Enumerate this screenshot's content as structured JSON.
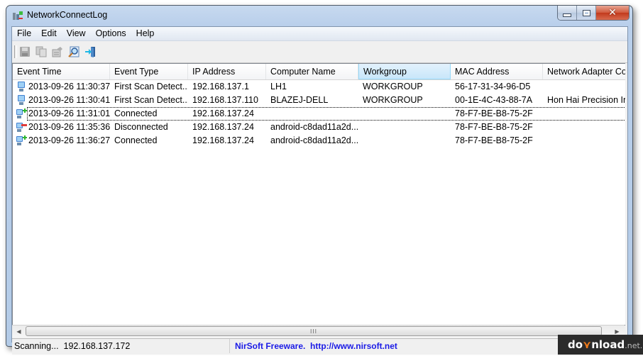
{
  "window": {
    "title": "NetworkConnectLog",
    "caption_buttons": {
      "minimize": "minimize",
      "maximize": "maximize",
      "close": "✕"
    }
  },
  "menu": [
    {
      "label": "File"
    },
    {
      "label": "Edit"
    },
    {
      "label": "View"
    },
    {
      "label": "Options"
    },
    {
      "label": "Help"
    }
  ],
  "toolbar": [
    {
      "icon": "save-icon",
      "enabled": false
    },
    {
      "icon": "copy-icon",
      "enabled": false
    },
    {
      "icon": "properties-icon",
      "enabled": false
    },
    {
      "icon": "find-icon",
      "enabled": true
    },
    {
      "icon": "exit-icon",
      "enabled": true
    }
  ],
  "table": {
    "columns": [
      {
        "label": "Event Time"
      },
      {
        "label": "Event Type"
      },
      {
        "label": "IP Address"
      },
      {
        "label": "Computer Name"
      },
      {
        "label": "Workgroup",
        "sorted": true
      },
      {
        "label": "MAC Address"
      },
      {
        "label": "Network Adapter Company"
      }
    ],
    "rows": [
      {
        "icon": "computer",
        "event_time": "2013-09-26 11:30:37",
        "event_type": "First Scan Detect...",
        "ip": "192.168.137.1",
        "computer": "LH1",
        "workgroup": "WORKGROUP",
        "mac": "56-17-31-34-96-D5",
        "adapter": ""
      },
      {
        "icon": "computer",
        "event_time": "2013-09-26 11:30:41",
        "event_type": "First Scan Detect...",
        "ip": "192.168.137.110",
        "computer": "BLAZEJ-DELL",
        "workgroup": "WORKGROUP",
        "mac": "00-1E-4C-43-88-7A",
        "adapter": "Hon Hai Precision Ind."
      },
      {
        "icon": "computer-connected",
        "event_time": "2013-09-26 11:31:01",
        "event_type": "Connected",
        "ip": "192.168.137.24",
        "computer": "",
        "workgroup": "",
        "mac": "78-F7-BE-B8-75-2F",
        "adapter": "",
        "focused": true
      },
      {
        "icon": "computer-disconnected",
        "event_time": "2013-09-26 11:35:36",
        "event_type": "Disconnected",
        "ip": "192.168.137.24",
        "computer": "android-c8dad11a2d...",
        "workgroup": "",
        "mac": "78-F7-BE-B8-75-2F",
        "adapter": ""
      },
      {
        "icon": "computer-connected",
        "event_time": "2013-09-26 11:36:27",
        "event_type": "Connected",
        "ip": "192.168.137.24",
        "computer": "android-c8dad11a2d...",
        "workgroup": "",
        "mac": "78-F7-BE-B8-75-2F",
        "adapter": ""
      }
    ]
  },
  "hscroll": {
    "grip": "III"
  },
  "status": {
    "left": "Scanning...  192.168.137.172",
    "link": "NirSoft Freeware.  http://www.nirsoft.net"
  },
  "watermark": {
    "pre": "do",
    "arrow": "¥",
    "post": "nload",
    "tld": ".net.pl"
  }
}
